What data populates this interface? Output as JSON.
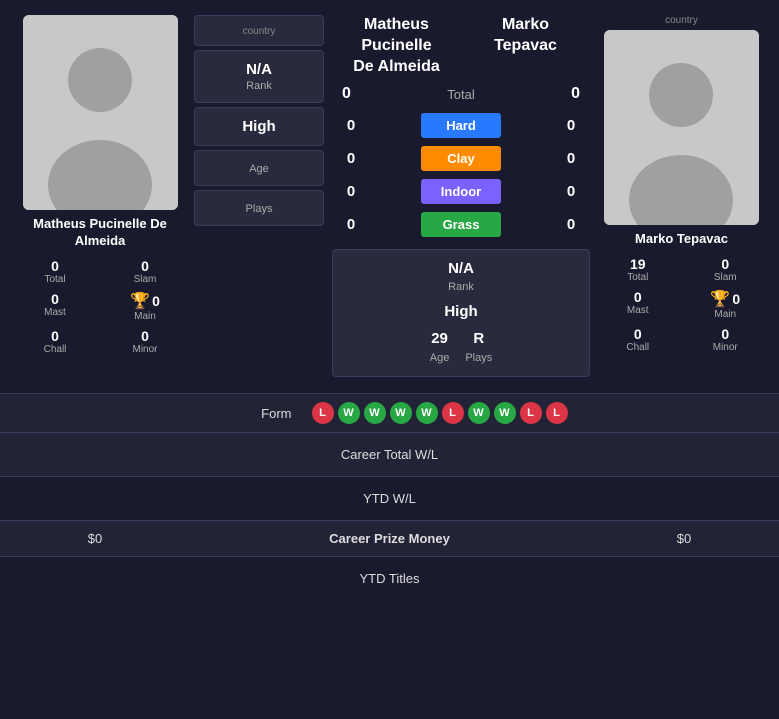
{
  "player1": {
    "name": "Matheus Pucinelle De Almeida",
    "name_short": "Matheus Pucinelle De Almeida",
    "country": "country",
    "rank": "N/A",
    "rank_label": "Rank",
    "high": "High",
    "high_label": "",
    "age_label": "Age",
    "plays_label": "Plays",
    "stats": {
      "total": "0",
      "total_label": "Total",
      "slam": "0",
      "slam_label": "Slam",
      "mast": "0",
      "mast_label": "Mast",
      "main": "0",
      "main_label": "Main",
      "chall": "0",
      "chall_label": "Chall",
      "minor": "0",
      "minor_label": "Minor"
    },
    "prize": "$0"
  },
  "player2": {
    "name_line1": "Marko",
    "name_line2": "Tepavac",
    "name": "Marko Tepavac",
    "country": "country",
    "rank": "N/A",
    "rank_label": "Rank",
    "high": "High",
    "high_label": "",
    "age": "29",
    "age_label": "Age",
    "plays": "R",
    "plays_label": "Plays",
    "stats": {
      "total": "19",
      "total_label": "Total",
      "slam": "0",
      "slam_label": "Slam",
      "mast": "0",
      "mast_label": "Mast",
      "main": "0",
      "main_label": "Main",
      "chall": "0",
      "chall_label": "Chall",
      "minor": "0",
      "minor_label": "Minor"
    },
    "prize": "$0"
  },
  "player1_header": {
    "name_line1": "Matheus Pucinelle",
    "name_line2": "De Almeida"
  },
  "player2_header": {
    "name_line1": "Marko",
    "name_line2": "Tepavac"
  },
  "courts": {
    "total_label": "Total",
    "p1_total": "0",
    "p2_total": "0",
    "hard_label": "Hard",
    "p1_hard": "0",
    "p2_hard": "0",
    "clay_label": "Clay",
    "p1_clay": "0",
    "p2_clay": "0",
    "indoor_label": "Indoor",
    "p1_indoor": "0",
    "p2_indoor": "0",
    "grass_label": "Grass",
    "p1_grass": "0",
    "p2_grass": "0"
  },
  "bottom": {
    "form_label": "Form",
    "form_badges": [
      {
        "result": "L"
      },
      {
        "result": "W"
      },
      {
        "result": "W"
      },
      {
        "result": "W"
      },
      {
        "result": "W"
      },
      {
        "result": "L"
      },
      {
        "result": "W"
      },
      {
        "result": "W"
      },
      {
        "result": "L"
      },
      {
        "result": "L"
      }
    ],
    "career_wl_label": "Career Total W/L",
    "ytd_wl_label": "YTD W/L",
    "career_prize_label": "Career Prize Money",
    "ytd_titles_label": "YTD Titles"
  }
}
